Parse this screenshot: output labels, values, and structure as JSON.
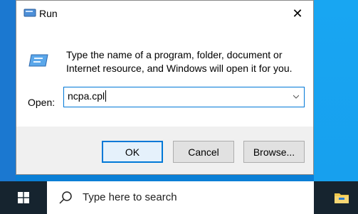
{
  "dialog": {
    "title": "Run",
    "description": "Type the name of a program, folder, document or Internet resource, and Windows will open it for you.",
    "open_label": "Open:",
    "open_value": "ncpa.cpl",
    "buttons": {
      "ok": "OK",
      "cancel": "Cancel",
      "browse": "Browse..."
    },
    "close_glyph": "✕",
    "icons": [
      "run-icon",
      "close-icon",
      "chevron-down-icon"
    ]
  },
  "taskbar": {
    "search_placeholder": "Type here to search",
    "icons": [
      "windows-start-icon",
      "search-icon",
      "file-explorer-icon"
    ]
  },
  "colors": {
    "desktop": "#0a7fd6",
    "taskbar": "#16242f",
    "accent": "#0078d7",
    "footer": "#f0f0f0"
  }
}
